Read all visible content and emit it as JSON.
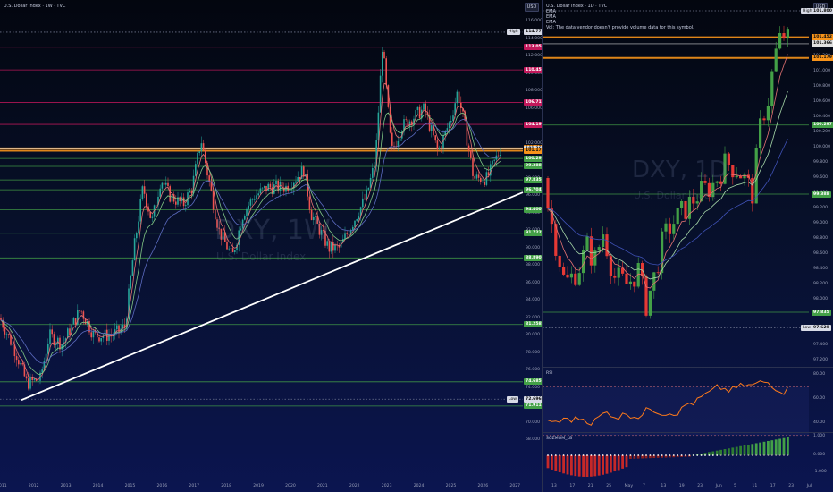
{
  "left_chart": {
    "title": "U.S. Dollar Index · 1W · TVC",
    "currency": "USD",
    "watermark_symbol": "DXY, 1W",
    "watermark_name": "U.S. Dollar Index",
    "y_ticks": [
      "116.000",
      "114.000",
      "112.000",
      "110.000",
      "108.000",
      "106.000",
      "104.000",
      "102.000",
      "100.000",
      "98.000",
      "96.000",
      "94.000",
      "92.000",
      "90.000",
      "88.000",
      "86.000",
      "84.000",
      "82.000",
      "80.000",
      "78.000",
      "76.000",
      "74.000",
      "72.000",
      "70.000",
      "68.000"
    ],
    "x_ticks": [
      "2011",
      "2012",
      "2013",
      "2014",
      "2015",
      "2016",
      "2017",
      "2018",
      "2019",
      "2020",
      "2021",
      "2022",
      "2023",
      "2024",
      "2025",
      "2026",
      "2027"
    ],
    "price_tags": [
      {
        "label": "High",
        "value": "114.778",
        "color": "#d8dbe6",
        "text": "#111"
      },
      {
        "label": "",
        "value": "113.051",
        "color": "#c2185b",
        "text": "#fff"
      },
      {
        "label": "",
        "value": "110.450",
        "color": "#c2185b",
        "text": "#fff"
      },
      {
        "label": "",
        "value": "106.713",
        "color": "#c2185b",
        "text": "#fff"
      },
      {
        "label": "",
        "value": "104.198",
        "color": "#c2185b",
        "text": "#fff"
      },
      {
        "label": "",
        "value": "101.452",
        "color": "#f7931a",
        "text": "#111"
      },
      {
        "label": "",
        "value": "101.366",
        "color": "#e0e0e0",
        "text": "#111"
      },
      {
        "label": "",
        "value": "101.179",
        "color": "#f7931a",
        "text": "#111"
      },
      {
        "label": "",
        "value": "100.297",
        "color": "#43a047",
        "text": "#fff"
      },
      {
        "label": "",
        "value": "99.388",
        "color": "#43a047",
        "text": "#fff"
      },
      {
        "label": "",
        "value": "97.835",
        "color": "#43a047",
        "text": "#fff"
      },
      {
        "label": "",
        "value": "96.704",
        "color": "#43a047",
        "text": "#fff"
      },
      {
        "label": "",
        "value": "94.400",
        "color": "#43a047",
        "text": "#fff"
      },
      {
        "label": "",
        "value": "91.722",
        "color": "#43a047",
        "text": "#fff"
      },
      {
        "label": "",
        "value": "88.890",
        "color": "#43a047",
        "text": "#fff"
      },
      {
        "label": "",
        "value": "81.258",
        "color": "#43a047",
        "text": "#fff"
      },
      {
        "label": "",
        "value": "74.685",
        "color": "#43a047",
        "text": "#fff"
      },
      {
        "label": "Low",
        "value": "72.696",
        "color": "#d8dbe6",
        "text": "#111"
      },
      {
        "label": "",
        "value": "71.911",
        "color": "#43a047",
        "text": "#fff"
      }
    ]
  },
  "right_chart": {
    "title": "U.S. Dollar Index · 1D · TVC",
    "currency": "USD",
    "legend": [
      "EMA",
      "EMA",
      "EMA",
      "Vol: The data vendor doesn't provide volume data for this symbol."
    ],
    "watermark_symbol": "DXY, 1D",
    "watermark_name": "U.S. Dollar Index",
    "y_ticks": [
      "101.400",
      "101.200",
      "101.000",
      "100.800",
      "100.600",
      "100.400",
      "100.200",
      "100.000",
      "99.800",
      "99.600",
      "99.400",
      "99.200",
      "99.000",
      "98.800",
      "98.600",
      "98.400",
      "98.200",
      "98.000",
      "97.800",
      "97.600",
      "97.400",
      "97.200"
    ],
    "x_ticks": [
      "13",
      "17",
      "21",
      "25",
      "May",
      "7",
      "13",
      "19",
      "23",
      "Jun",
      "5",
      "11",
      "17",
      "23",
      "Jul"
    ],
    "price_tags": [
      {
        "label": "High",
        "value": "101.800",
        "color": "#d8dbe6",
        "text": "#111"
      },
      {
        "label": "",
        "value": "101.452",
        "color": "#f7931a",
        "text": "#111"
      },
      {
        "label": "",
        "value": "101.366",
        "color": "#e0e0e0",
        "text": "#111"
      },
      {
        "label": "",
        "value": "101.179",
        "color": "#f7931a",
        "text": "#111"
      },
      {
        "label": "",
        "value": "100.297",
        "color": "#43a047",
        "text": "#fff"
      },
      {
        "label": "",
        "value": "99.388",
        "color": "#43a047",
        "text": "#fff"
      },
      {
        "label": "",
        "value": "97.835",
        "color": "#43a047",
        "text": "#fff"
      },
      {
        "label": "Low",
        "value": "97.629",
        "color": "#d8dbe6",
        "text": "#111"
      }
    ],
    "rsi": {
      "label": "RSI",
      "ticks": [
        "80.00",
        "60.00",
        "40.00"
      ]
    },
    "mom": {
      "label": "SQZMOM_LB",
      "ticks": [
        "1.000",
        "0.000",
        "-1.000"
      ]
    }
  }
}
